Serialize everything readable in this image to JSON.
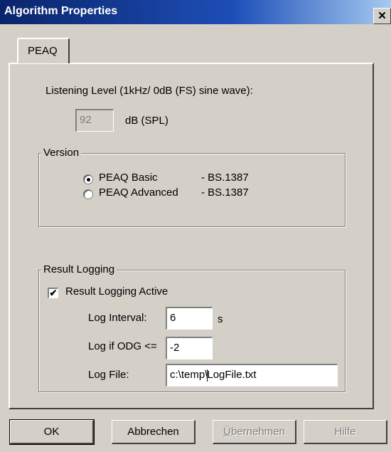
{
  "window": {
    "title": "Algorithm Properties",
    "close_glyph": "✕"
  },
  "tabs": [
    {
      "label": "PEAQ",
      "active": true
    }
  ],
  "listening": {
    "label": "Listening Level (1kHz/ 0dB (FS) sine wave):",
    "value": "92",
    "unit": "dB (SPL)"
  },
  "version": {
    "legend": "Version",
    "options": [
      {
        "label": "PEAQ Basic",
        "spec": "- BS.1387",
        "selected": true
      },
      {
        "label": "PEAQ Advanced",
        "spec": "- BS.1387",
        "selected": false
      }
    ]
  },
  "logging": {
    "legend": "Result Logging",
    "active_label": "Result Logging Active",
    "active_checked": true,
    "interval_label": "Log Interval:",
    "interval_value": "6",
    "interval_unit": "s",
    "odg_label": "Log if ODG <=",
    "odg_value": "-2",
    "file_label": "Log File:",
    "file_value_before_caret": "c:\\temp\\",
    "file_value_after_caret": "LogFile.txt"
  },
  "buttons": {
    "ok": "OK",
    "cancel": "Abbrechen",
    "apply_first": "Ü",
    "apply_rest": "bernehmen",
    "help": "Hilfe"
  }
}
